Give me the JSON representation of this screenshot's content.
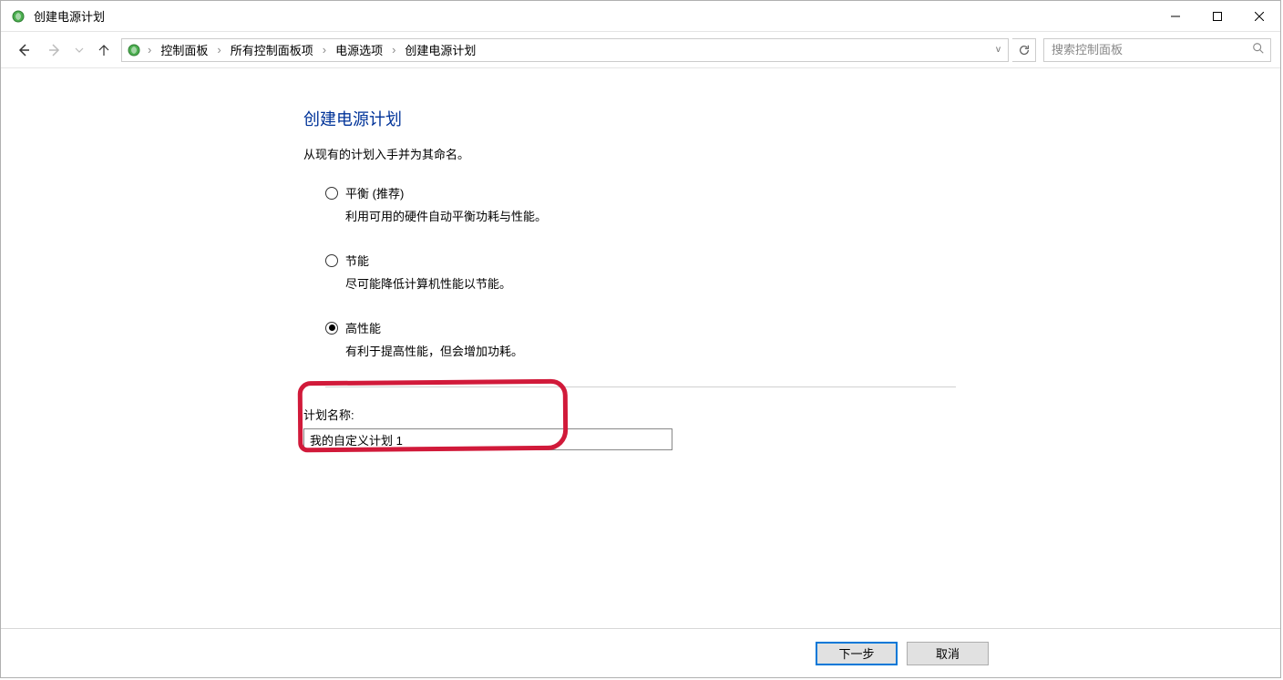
{
  "window": {
    "title": "创建电源计划"
  },
  "breadcrumbs": {
    "items": [
      "控制面板",
      "所有控制面板项",
      "电源选项",
      "创建电源计划"
    ]
  },
  "search": {
    "placeholder": "搜索控制面板"
  },
  "page": {
    "heading": "创建电源计划",
    "subheading": "从现有的计划入手并为其命名。"
  },
  "options": [
    {
      "label": "平衡 (推荐)",
      "description": "利用可用的硬件自动平衡功耗与性能。",
      "selected": false
    },
    {
      "label": "节能",
      "description": "尽可能降低计算机性能以节能。",
      "selected": false
    },
    {
      "label": "高性能",
      "description": "有利于提高性能，但会增加功耗。",
      "selected": true
    }
  ],
  "planName": {
    "label": "计划名称:",
    "value": "我的自定义计划 1"
  },
  "buttons": {
    "next": "下一步",
    "cancel": "取消"
  }
}
